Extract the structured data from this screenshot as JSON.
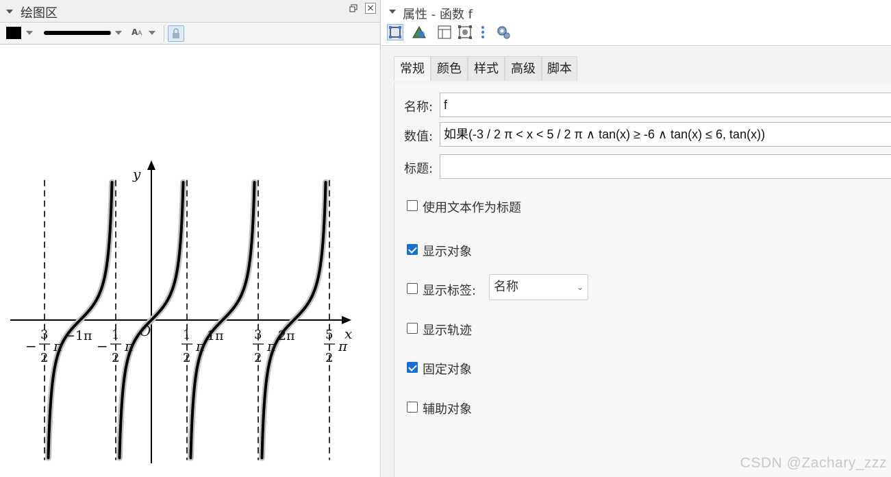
{
  "left_panel": {
    "title": "绘图区",
    "toolbar": {
      "color": "#000000",
      "icons": [
        "color-swatch",
        "line-style",
        "label-style",
        "lock"
      ]
    }
  },
  "graph": {
    "function": "tan(x)",
    "domain": [
      "-3/2 π",
      "5/2 π"
    ],
    "range": [
      -6,
      6
    ],
    "curve_color": "#000000",
    "highlight_color": "#c0c0c0",
    "asymptote_color": "#333333",
    "axis_labels": {
      "x": "x",
      "y": "y",
      "origin": "O"
    },
    "x_tick_labels": [
      {
        "sign": "−",
        "num": "3",
        "den": "2",
        "pi": "π"
      },
      {
        "text": "−1π"
      },
      {
        "sign": "−",
        "num": "1",
        "den": "2",
        "pi": "π"
      },
      {
        "num": "1",
        "den": "2",
        "pi": "π"
      },
      {
        "text": "1π"
      },
      {
        "num": "3",
        "den": "2",
        "pi": "π"
      },
      {
        "text": "2π"
      },
      {
        "num": "5",
        "den": "2",
        "pi": "π"
      }
    ]
  },
  "right_panel": {
    "title": "属性 - 函数 f",
    "toolbar_icons": [
      "object-props-icon",
      "graphics-icon",
      "layout-icon",
      "algebra-icon",
      "more-icon",
      "settings-icon"
    ],
    "tabs": [
      {
        "label": "常规",
        "active": true
      },
      {
        "label": "颜色"
      },
      {
        "label": "样式"
      },
      {
        "label": "高级"
      },
      {
        "label": "脚本"
      }
    ],
    "fields": {
      "name_label": "名称:",
      "name_value": "f",
      "value_label": "数值:",
      "value_value": "如果(-3 / 2 π < x < 5 / 2 π ∧ tan(x) ≥ -6 ∧ tan(x) ≤ 6, tan(x))",
      "caption_label": "标题:",
      "caption_value": ""
    },
    "checkboxes": {
      "use_text_as_caption": {
        "label": "使用文本作为标题",
        "checked": false
      },
      "show_object": {
        "label": "显示对象",
        "checked": true
      },
      "show_label": {
        "label": "显示标签:",
        "checked": false,
        "select_value": "名称"
      },
      "show_trace": {
        "label": "显示轨迹",
        "checked": false
      },
      "fix_object": {
        "label": "固定对象",
        "checked": true
      },
      "auxiliary_object": {
        "label": "辅助对象",
        "checked": false
      }
    }
  },
  "watermark": "CSDN @Zachary_zzz"
}
